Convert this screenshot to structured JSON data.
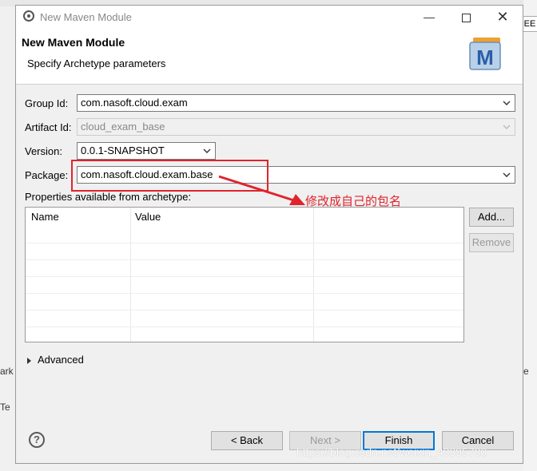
{
  "background": {
    "right_tab_label": "EE",
    "left_fragment": "ark",
    "right_fragment": "e",
    "left_tab_fragment": "Te"
  },
  "window": {
    "title": "New Maven Module"
  },
  "header": {
    "title": "New Maven Module",
    "description": "Specify Archetype parameters",
    "logo_letter": "M"
  },
  "form": {
    "group_id": {
      "label": "Group Id:",
      "value": "com.nasoft.cloud.exam"
    },
    "artifact_id": {
      "label": "Artifact Id:",
      "value": "cloud_exam_base"
    },
    "version": {
      "label": "Version:",
      "value": "0.0.1-SNAPSHOT"
    },
    "package": {
      "label": "Package:",
      "value": "com.nasoft.cloud.exam.base"
    }
  },
  "annotation": {
    "text": "修改成自己的包名",
    "color": "#e0242c"
  },
  "properties": {
    "label": "Properties available from archetype:",
    "columns": [
      "Name",
      "Value"
    ],
    "rows": []
  },
  "side_buttons": {
    "add": "Add...",
    "remove": "Remove"
  },
  "advanced_label": "Advanced",
  "footer": {
    "help_symbol": "?",
    "back": "< Back",
    "next": "Next >",
    "finish": "Finish",
    "cancel": "Cancel"
  },
  "watermark": "https://blog.csdn.net/weixin_43395780",
  "colors": {
    "accent": "#0078d7",
    "highlight": "#e0242c"
  }
}
